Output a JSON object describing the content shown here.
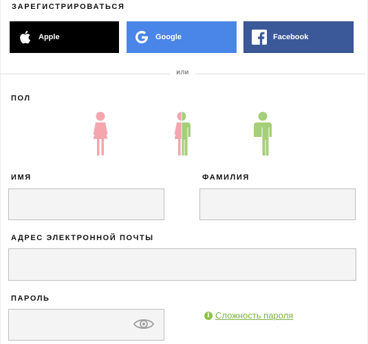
{
  "signup": {
    "title": "ЗАРЕГИСТРИРОВАТЬСЯ"
  },
  "social": {
    "apple": {
      "label": "Apple",
      "icon": "apple-icon",
      "color": "#000000"
    },
    "google": {
      "label": "Google",
      "icon": "google-icon",
      "color": "#4a86e8"
    },
    "facebook": {
      "label": "Facebook",
      "icon": "facebook-icon",
      "color": "#3b5998"
    }
  },
  "divider": {
    "label": "или"
  },
  "gender": {
    "heading": "ПОЛ",
    "options": [
      {
        "icon": "female-icon",
        "color": "#f4a5ae"
      },
      {
        "icon": "unisex-icon",
        "colors": [
          "#f4a5ae",
          "#a5cf78"
        ]
      },
      {
        "icon": "male-icon",
        "color": "#a5cf78"
      }
    ]
  },
  "first_name": {
    "label": "ИМЯ",
    "value": ""
  },
  "last_name": {
    "label": "ФАМИЛИЯ",
    "value": ""
  },
  "email": {
    "label": "АДРЕС ЭЛЕКТРОННОЙ ПОЧТЫ",
    "value": ""
  },
  "password": {
    "label": "ПАРОЛЬ",
    "value": "",
    "toggle_icon": "eye-icon"
  },
  "password_strength": {
    "label": "Сложность пароля",
    "icon": "info-icon",
    "color": "#7cb342"
  }
}
